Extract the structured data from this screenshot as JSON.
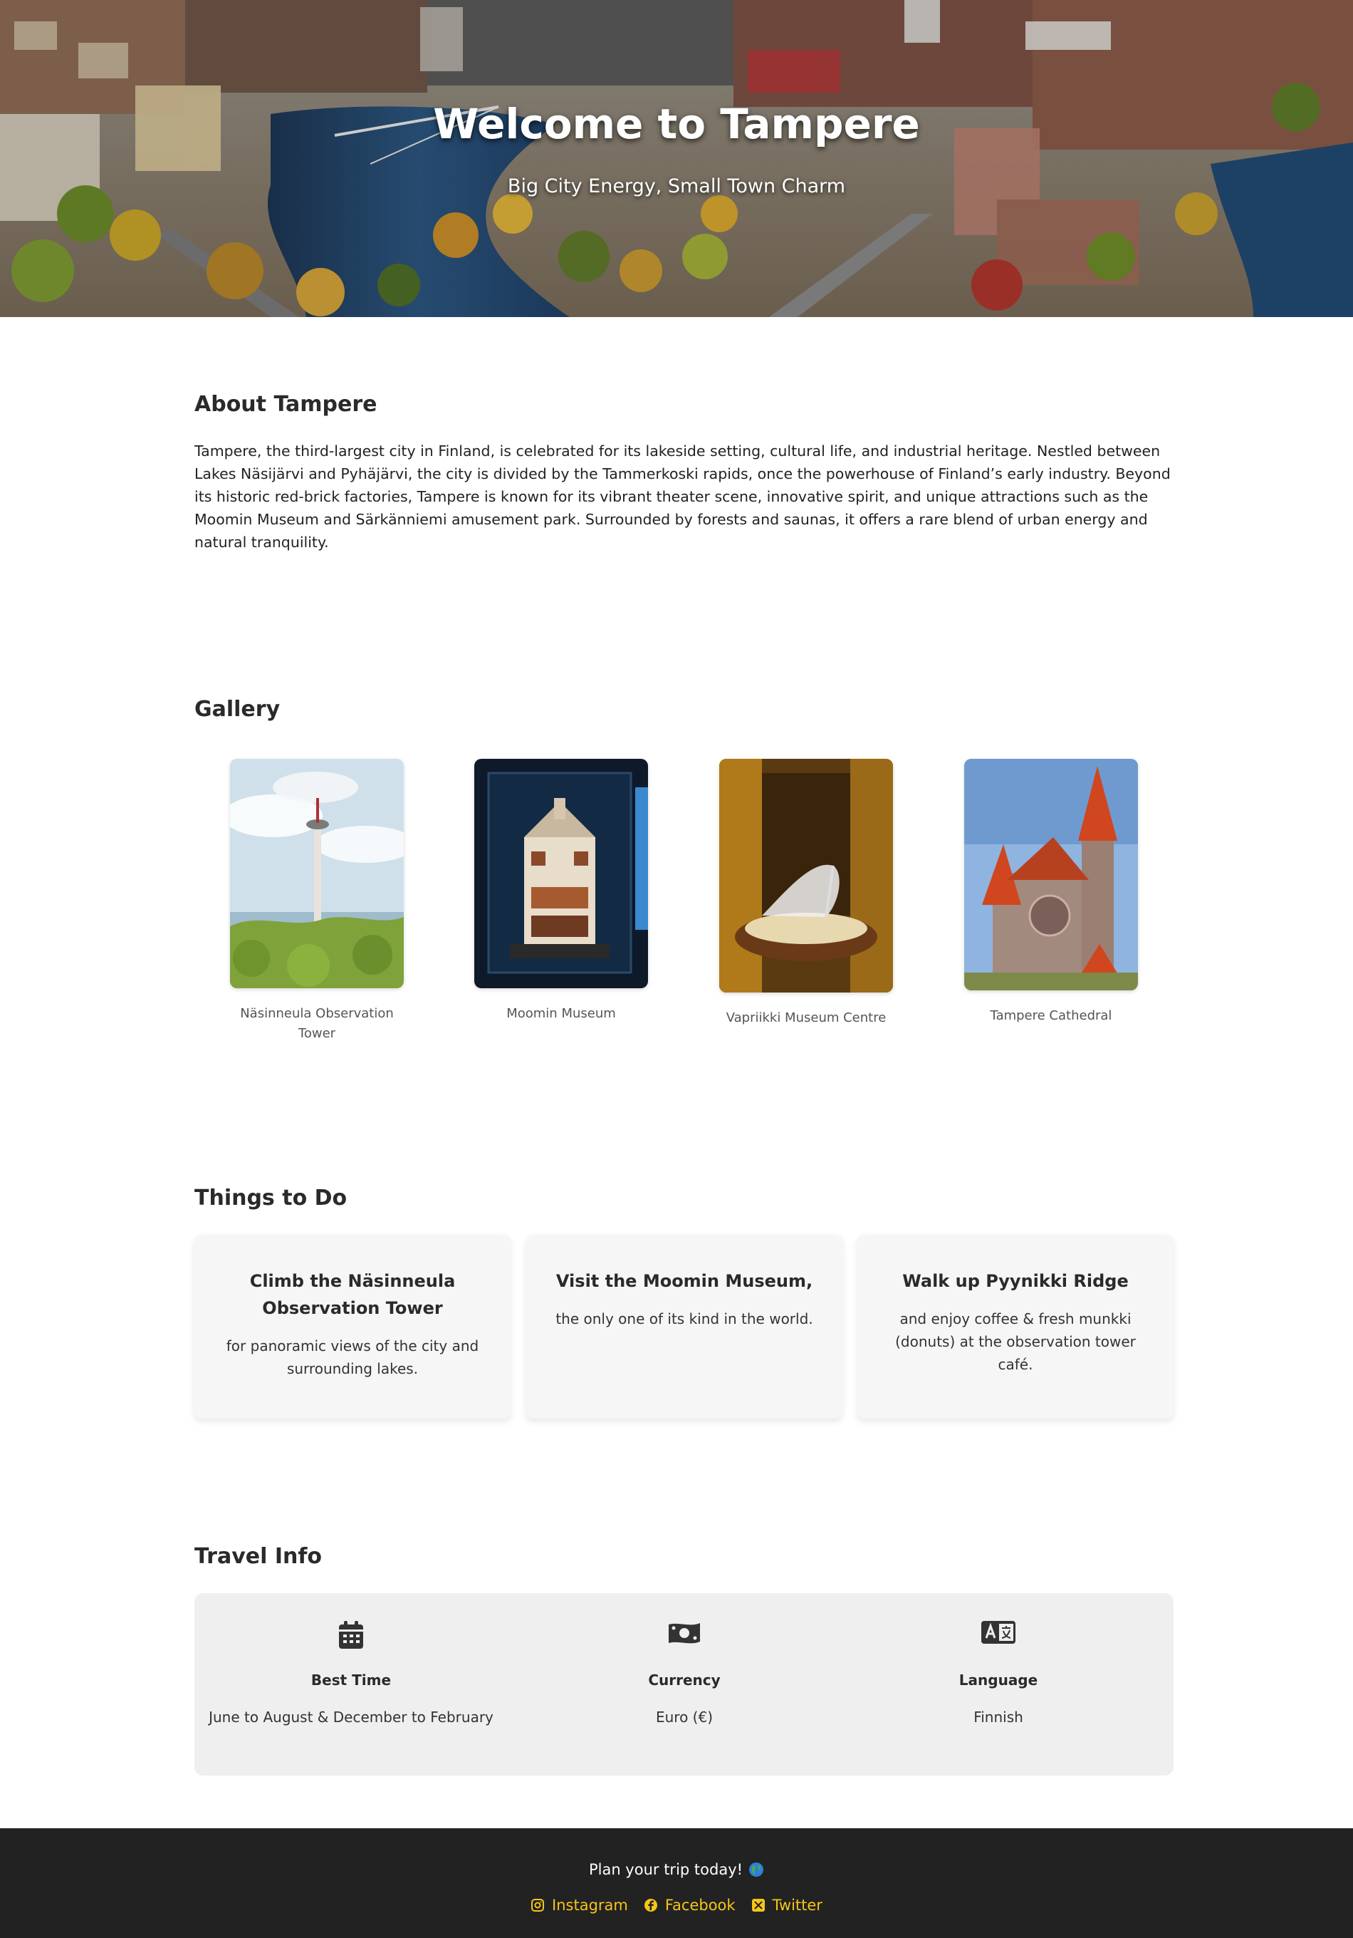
{
  "hero": {
    "title": "Welcome to Tampere",
    "subtitle": "Big City Energy, Small Town Charm"
  },
  "about": {
    "heading": "About Tampere",
    "text": "Tampere, the third-largest city in Finland, is celebrated for its lakeside setting, cultural life, and industrial heritage. Nestled between Lakes Näsijärvi and Pyhäjärvi, the city is divided by the Tammerkoski rapids, once the powerhouse of Finland’s early industry. Beyond its historic red-brick factories, Tampere is known for its vibrant theater scene, innovative spirit, and unique attractions such as the Moomin Museum and Särkänniemi amusement park. Surrounded by forests and saunas, it offers a rare blend of urban energy and natural tranquility."
  },
  "gallery": {
    "heading": "Gallery",
    "items": [
      {
        "caption": "Näsinneula Observation Tower",
        "icon": "tower-photo"
      },
      {
        "caption": "Moomin Museum",
        "icon": "museum-photo"
      },
      {
        "caption": "Vapriikki Museum Centre",
        "icon": "glass-slipper-photo"
      },
      {
        "caption": "Tampere Cathedral",
        "icon": "cathedral-photo"
      }
    ]
  },
  "things": {
    "heading": "Things to Do",
    "cards": [
      {
        "title": "Climb the Näsinneula Observation Tower",
        "text": "for panoramic views of the city and surrounding lakes."
      },
      {
        "title": "Visit the Moomin Museum,",
        "text": "the only one of its kind in the world."
      },
      {
        "title": "Walk up Pyynikki Ridge",
        "text": "and enjoy coffee & fresh munkki (donuts) at the observation tower café."
      }
    ]
  },
  "travel": {
    "heading": "Travel Info",
    "items": [
      {
        "label": "Best Time",
        "value": "June to August & December to February",
        "icon": "calendar-icon"
      },
      {
        "label": "Currency",
        "value": "Euro (€)",
        "icon": "money-icon"
      },
      {
        "label": "Language",
        "value": "Finnish",
        "icon": "language-icon"
      }
    ]
  },
  "footer": {
    "cta": "Plan your trip today!",
    "links": [
      {
        "label": "Instagram",
        "icon": "instagram-icon"
      },
      {
        "label": "Facebook",
        "icon": "facebook-icon"
      },
      {
        "label": "Twitter",
        "icon": "x-twitter-icon"
      }
    ],
    "accent_color": "#f5c518"
  }
}
